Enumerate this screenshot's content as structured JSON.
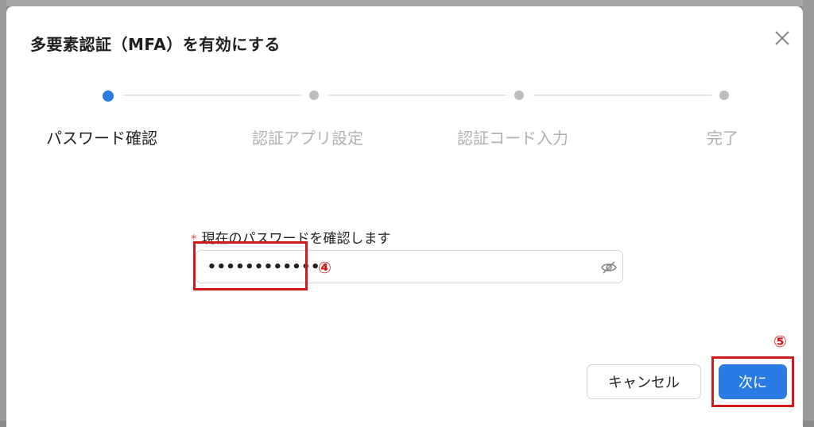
{
  "dialog": {
    "title": "多要素認証（MFA）を有効にする",
    "close_icon": "close-icon"
  },
  "steps": [
    {
      "label": "パスワード確認",
      "state": "active"
    },
    {
      "label": "認証アプリ設定",
      "state": "pending"
    },
    {
      "label": "認証コード入力",
      "state": "pending"
    },
    {
      "label": "完了",
      "state": "pending"
    }
  ],
  "form": {
    "required_mark": "*",
    "password_label": "現在のパスワードを確認します",
    "password_value": "••••••••••••",
    "visibility_icon": "eye-slash-icon"
  },
  "annotations": {
    "marker_4": "④",
    "marker_5": "⑤",
    "highlight_color": "#d11a1a"
  },
  "buttons": {
    "cancel_label": "キャンセル",
    "next_label": "次に"
  },
  "colors": {
    "accent": "#2a7be4",
    "step_inactive": "#bdbdbd"
  }
}
